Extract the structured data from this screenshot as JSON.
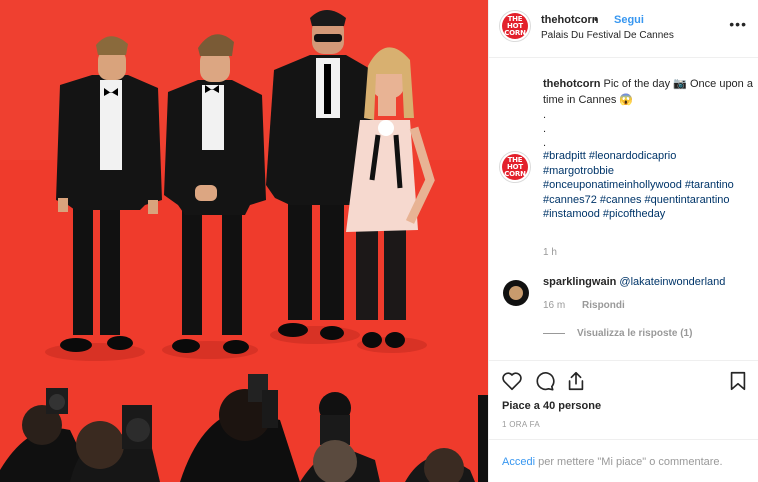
{
  "post": {
    "username": "thehotcorn",
    "separator": "•",
    "follow_label": "Segui",
    "location": "Palais Du Festival De Cannes",
    "more_label": "•••",
    "avatar_line1": "THE",
    "avatar_line2": "HOT",
    "avatar_line3": "CORN"
  },
  "caption": {
    "username": "thehotcorn",
    "text": "Pic of the day 📷 Once upon a time in Cannes 😱",
    "dots": [
      ".",
      ".",
      "."
    ],
    "hashtags": "#bradpitt #leonardodicaprio #margotrobbie #onceuponatimeinhollywood #tarantino #cannes72 #cannes #quentintarantino #instamood #picoftheday",
    "time": "1 h"
  },
  "comment": {
    "username": "sparklingwain",
    "mention": "@lakateinwonderland",
    "time": "16 m",
    "reply_label": "Rispondi",
    "view_replies": "Visualizza le risposte (1)"
  },
  "actions": {
    "likes": "Piace a 40 persone",
    "timestamp": "1 ORA FA",
    "login_link": "Accedi",
    "login_rest": " per mettere \"Mi piace\" o commentare."
  },
  "colors": {
    "carpet": "#ef3b2c",
    "link_blue": "#3897f0",
    "hashtag_blue": "#003569",
    "brand_red": "#e3202b"
  }
}
